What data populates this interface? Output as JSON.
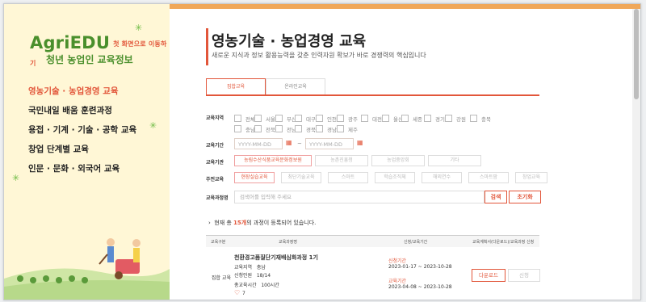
{
  "sidebar": {
    "logo": "AgriEDU",
    "logo_sub": "첫 화면으로 이동하기",
    "tagline": "청년 농업인 교육정보",
    "menu": [
      "영농기술 · 농업경영 교육",
      "국민내일 배움 훈련과정",
      "용접 · 기계 · 기술 · 공학 교육",
      "창업 단계별 교육",
      "인문 · 문화 · 외국어 교육"
    ]
  },
  "header": {
    "title": "영농기술 · 농업경영 교육",
    "subtitle": "새로운 지식과 정보 활용능력을 갖춘 인력자원 확보가 바로 경쟁력의 핵심입니다"
  },
  "tabs": [
    "집합교육",
    "온라인교육"
  ],
  "filters": {
    "region_label": "교육지역",
    "regions_row1": [
      "전체",
      "서울",
      "부산",
      "대구",
      "인천",
      "광주",
      "대전",
      "울산",
      "세종",
      "경기",
      "강원",
      "충북"
    ],
    "regions_row2": [
      "충남",
      "전북",
      "전남",
      "경북",
      "경남",
      "제주"
    ],
    "period_label": "교육기간",
    "date_from": "YYYY-MM-DD",
    "date_to": "YYYY-MM-DD",
    "tilde": "~",
    "org_label": "교육기관",
    "orgs": [
      "농림수산식품교육문화정보원",
      "농촌진흥청",
      "농업중앙회",
      "기타"
    ],
    "topic_label": "주전교육",
    "topics": [
      "현장실습교육",
      "최단기술교육",
      "스마트",
      "학습조직체",
      "해외연수",
      "스마트팜",
      "창업교육"
    ],
    "course_label": "교육과정명",
    "search_placeholder": "검색어를 입력해 주세요",
    "search_btn": "검색",
    "reset_btn": "초기화"
  },
  "results": {
    "prefix": "현재 총",
    "count": "15개",
    "suffix": "의 과정이 등록되어 있습니다."
  },
  "table": {
    "headers": [
      "교육구분",
      "교육과정명",
      "신청/교육기간",
      "교육계획서(다운로드)/교육과정 신청"
    ],
    "row": {
      "type": "집합 교육",
      "name": "천환경고품질단기재배심화과정 1기",
      "region_label": "교육지역",
      "region": "충남",
      "applicants_label": "신청인원",
      "applicants": "18/14",
      "hours_label": "총교육시간",
      "hours": "100시간",
      "likes": "7",
      "apply_label": "신청기간",
      "apply_period": "2023-01-17 ~ 2023-10-28",
      "edu_label": "교육기간",
      "edu_period": "2023-04-08 ~ 2023-10-28",
      "download": "다운로드",
      "apply_btn": "신청"
    }
  },
  "colors": {
    "accent": "#e2563a",
    "brand_green": "#4a8f2c",
    "sidebar_bg": "#fff7d6"
  }
}
